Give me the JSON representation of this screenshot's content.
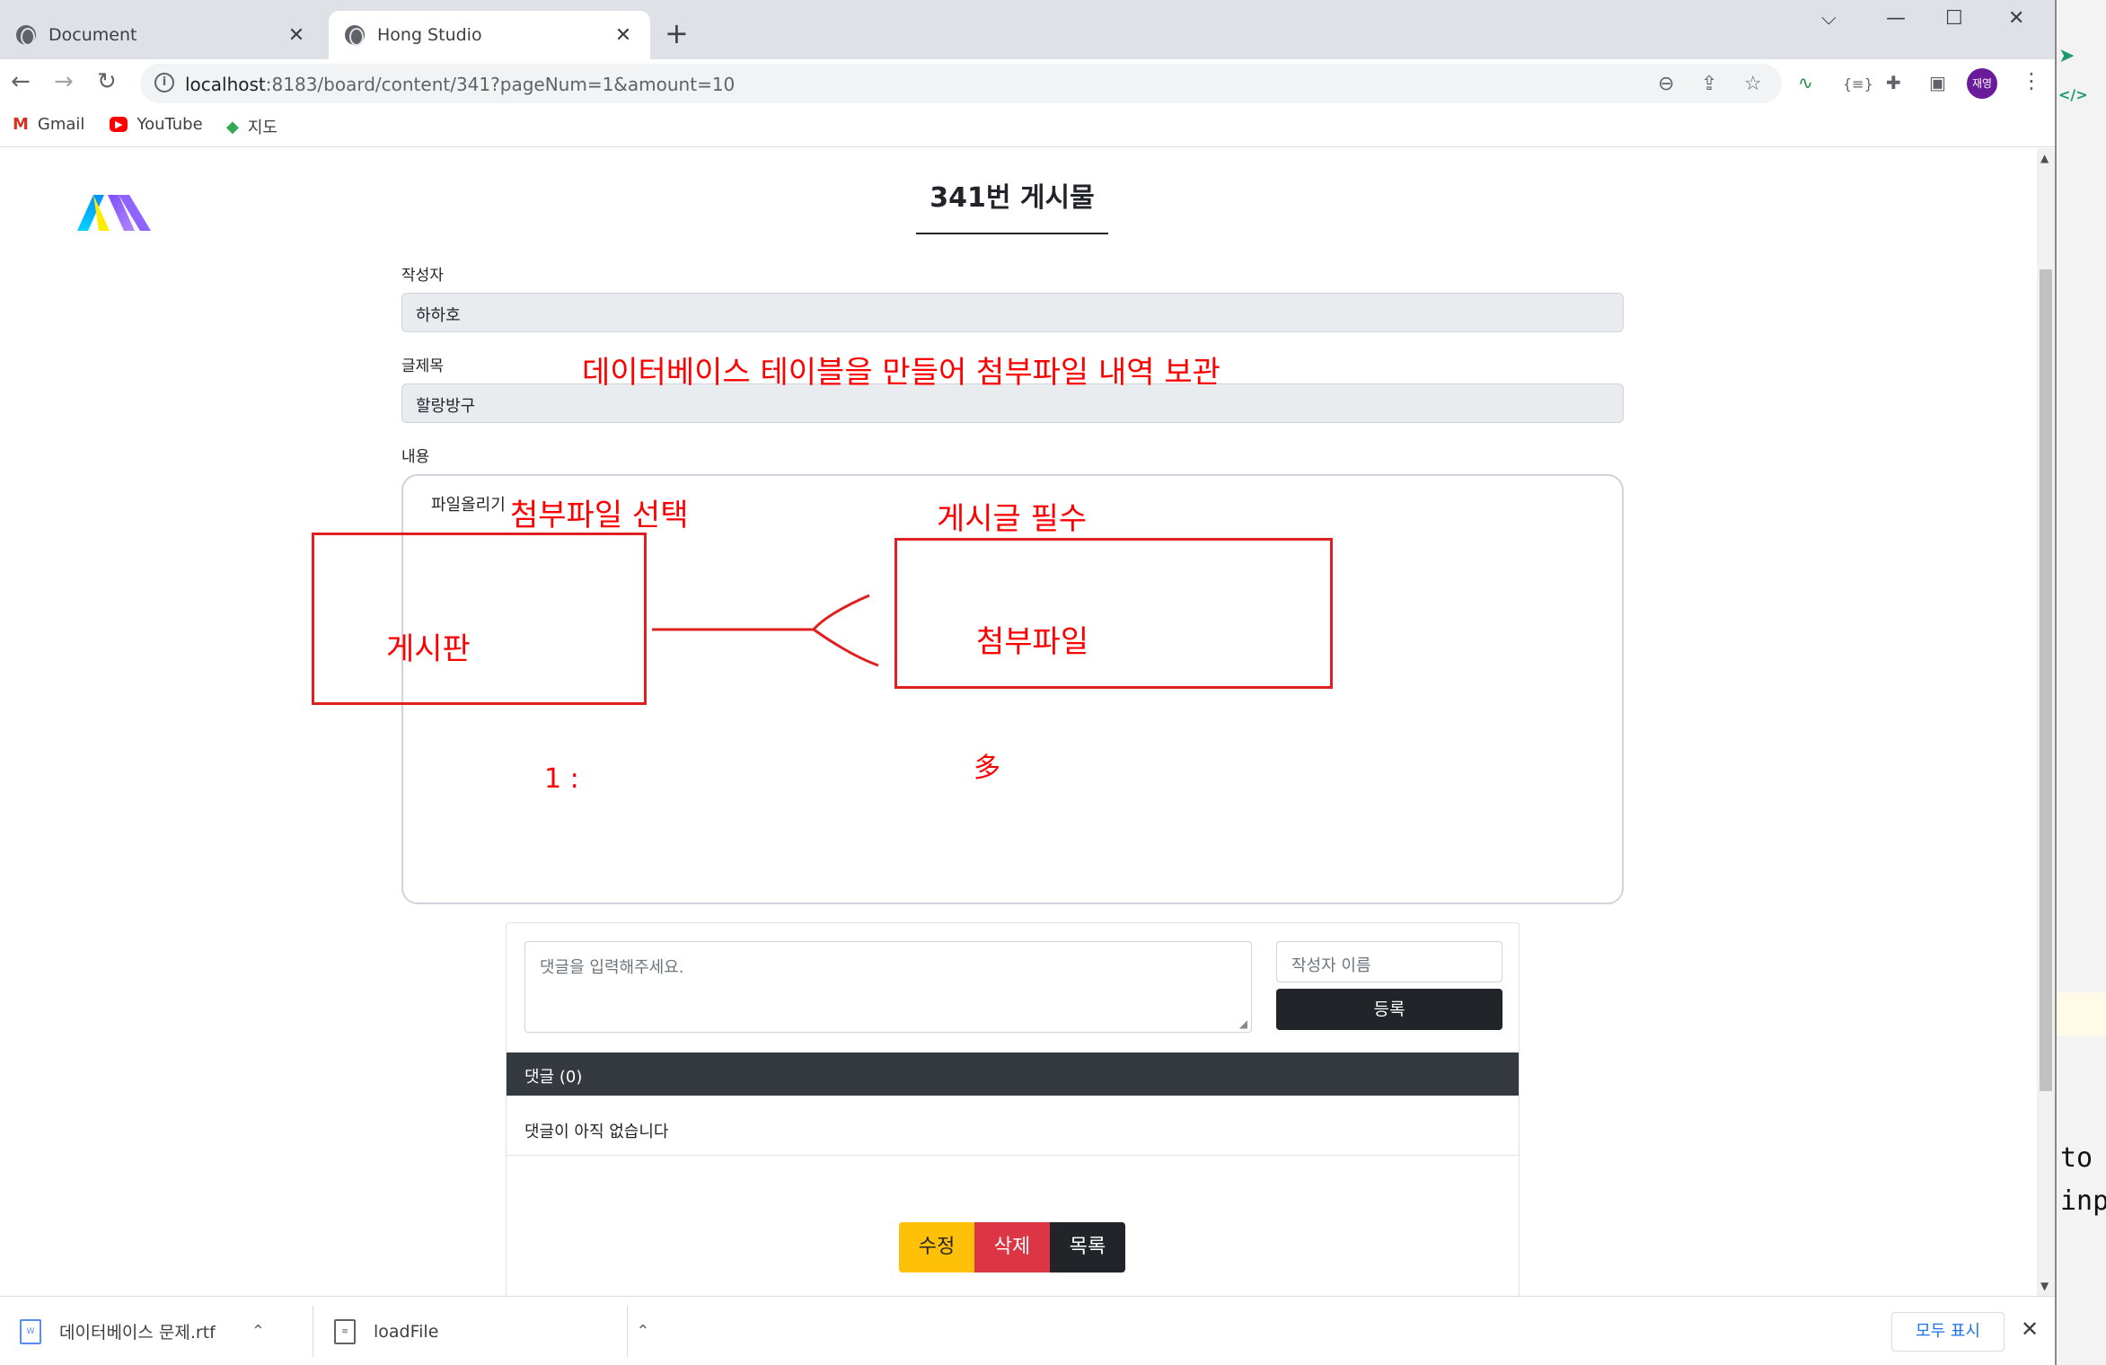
{
  "browser": {
    "tabs": [
      {
        "title": "Document",
        "close": "✕"
      },
      {
        "title": "Hong Studio",
        "close": "✕"
      }
    ],
    "new_tab": "+",
    "window_controls": {
      "dropdown": "⌵",
      "minimize": "—",
      "maximize": "☐",
      "close": "✕"
    },
    "url_host": "localhost",
    "url_rest": ":8183/board/content/341?pageNum=1&amount=10",
    "avatar": "재영",
    "bookmarks": [
      {
        "label": "Gmail",
        "icon": "gmail-icon"
      },
      {
        "label": "YouTube",
        "icon": "youtube-icon"
      },
      {
        "label": "지도",
        "icon": "maps-icon"
      }
    ]
  },
  "page": {
    "title": "341번 게시물",
    "writer_label": "작성자",
    "writer_value": "하하호",
    "subject_label": "글제목",
    "subject_value": "할랑방구",
    "content_label": "내용",
    "content_value": "파일올리기"
  },
  "comments": {
    "placeholder": "댓글을 입력해주세요.",
    "writer_placeholder": "작성자 이름",
    "submit_label": "등록",
    "header": "댓글 (0)",
    "empty_text": "댓글이 아직 없습니다"
  },
  "actions": {
    "edit": "수정",
    "delete": "삭제",
    "list": "목록"
  },
  "annotations": {
    "db_note": "데이터베이스 테이블을 만들어 첨부파일 내역 보관",
    "select_file": "첨부파일 선택",
    "post_required": "게시글 필수",
    "board": "게시판",
    "attachment": "첨부파일",
    "one": "1 :",
    "many": "多",
    "color": "#ff0000"
  },
  "downloads": {
    "items": [
      {
        "name": "데이터베이스 문제.rtf",
        "caret": "⌃"
      },
      {
        "name": "loadFile",
        "caret": "⌃"
      }
    ],
    "show_all": "모두 표시",
    "close": "✕"
  },
  "right_edge": {
    "code_line_1": "to",
    "code_line_2": "inp"
  }
}
